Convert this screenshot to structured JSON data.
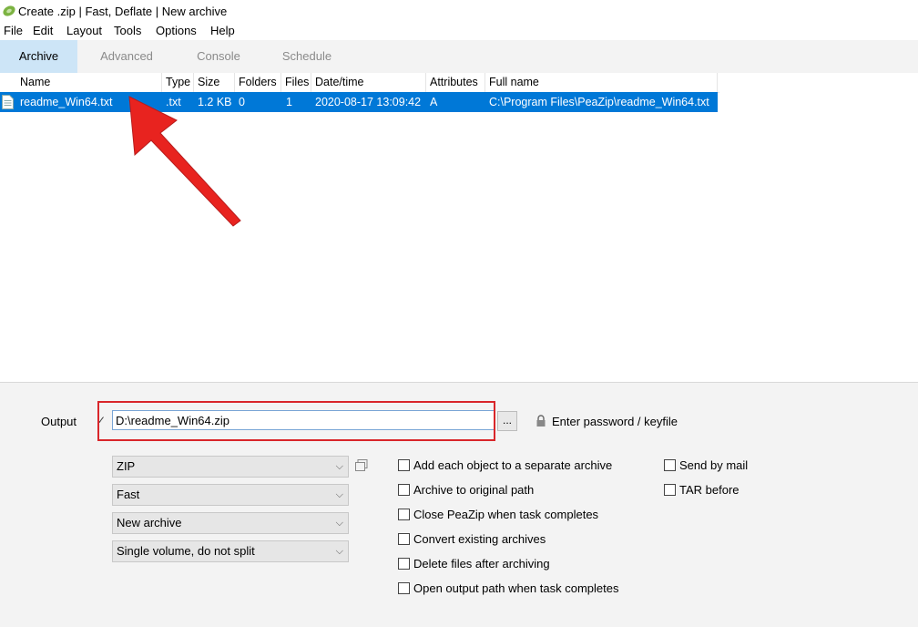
{
  "window": {
    "title": "Create .zip | Fast, Deflate | New archive"
  },
  "menu": [
    "File",
    "Edit",
    "Layout",
    "Tools",
    "Options",
    "Help"
  ],
  "tabs": [
    {
      "label": "Archive",
      "active": true
    },
    {
      "label": "Advanced",
      "active": false
    },
    {
      "label": "Console",
      "active": false
    },
    {
      "label": "Schedule",
      "active": false
    }
  ],
  "table": {
    "columns": [
      "Name",
      "Type",
      "Size",
      "Folders",
      "Files",
      "Date/time",
      "Attributes",
      "Full name"
    ],
    "rows": [
      {
        "name": "readme_Win64.txt",
        "type": ".txt",
        "size": "1.2 KB",
        "folders": "0",
        "files": "1",
        "datetime": "2020-08-17 13:09:42",
        "attributes": "A",
        "fullname": "C:\\Program Files\\PeaZip\\readme_Win64.txt",
        "selected": true
      }
    ]
  },
  "output": {
    "label": "Output",
    "value": "D:\\readme_Win64.zip",
    "browse_label": "...",
    "password_label": "Enter password / keyfile"
  },
  "selects": {
    "format": "ZIP",
    "level": "Fast",
    "mode": "New archive",
    "split": "Single volume, do not split"
  },
  "options_left": [
    "Add each object to a separate archive",
    "Archive to original path",
    "Close PeaZip when task completes",
    "Convert existing archives",
    "Delete files after archiving",
    "Open output path when task completes"
  ],
  "options_right": [
    "Send by mail",
    "TAR before"
  ],
  "colors": {
    "selection": "#0078d7",
    "active_tab": "#cde5f7",
    "annotation_red": "#d9262a",
    "arrow_red": "#e8231f"
  },
  "icons": {
    "app": "peazip-leaf-icon",
    "file": "text-file-icon",
    "lock": "lock-icon",
    "format_options": "options-icon"
  }
}
